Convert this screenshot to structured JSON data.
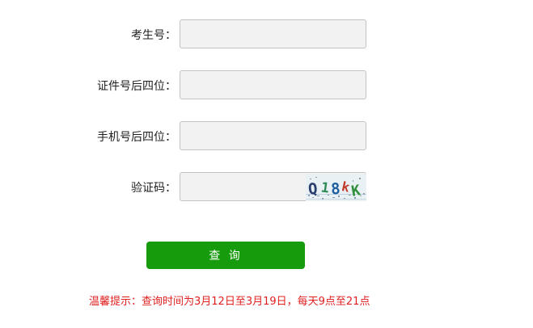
{
  "form": {
    "exam_number": {
      "label": "考生号：",
      "value": "",
      "placeholder": ""
    },
    "id_last_four": {
      "label": "证件号后四位：",
      "value": "",
      "placeholder": ""
    },
    "phone_last_four": {
      "label": "手机号后四位：",
      "value": "",
      "placeholder": ""
    },
    "captcha": {
      "label": "验证码：",
      "value": "",
      "placeholder": "",
      "image_text": "Q18K"
    },
    "submit_label": "查 询"
  },
  "tip": "温馨提示：查询时间为3月12日至3月19日，每天9点至21点",
  "colors": {
    "accent": "#159b0b",
    "tip_text": "#e02020",
    "field_bg": "#f2f2f2",
    "field_border": "#c3c3c3"
  }
}
